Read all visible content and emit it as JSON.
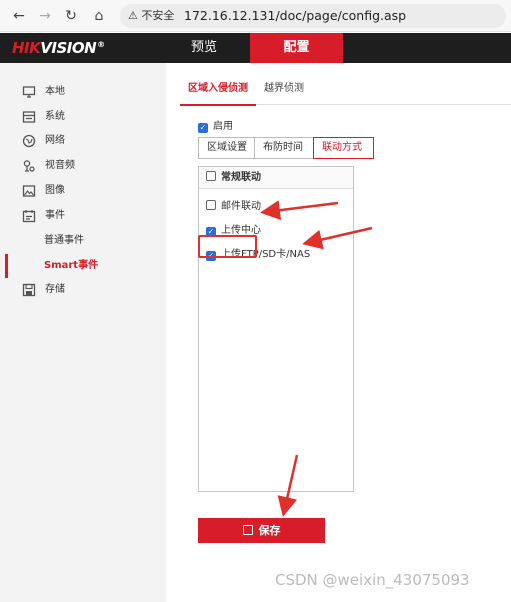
{
  "browser": {
    "security_warning": "不安全",
    "url": "172.16.12.131/doc/page/config.asp"
  },
  "header": {
    "logo": "HIKVISION",
    "menu": {
      "preview": "预览",
      "config": "配置"
    }
  },
  "sidebar": {
    "items": [
      {
        "label": "本地",
        "icon": "monitor-icon"
      },
      {
        "label": "系统",
        "icon": "system-icon"
      },
      {
        "label": "网络",
        "icon": "globe-icon"
      },
      {
        "label": "视音频",
        "icon": "microphone-icon"
      },
      {
        "label": "图像",
        "icon": "image-icon"
      },
      {
        "label": "事件",
        "icon": "calendar-icon"
      },
      {
        "label": "普通事件"
      },
      {
        "label": "Smart事件"
      },
      {
        "label": "存储",
        "icon": "storage-icon"
      }
    ]
  },
  "main": {
    "tabs": [
      "区域入侵侦测",
      "越界侦测"
    ],
    "enable_label": "启用",
    "subtabs": [
      "区域设置",
      "布防时间",
      "联动方式"
    ],
    "linkage": {
      "header": "常规联动",
      "options": [
        {
          "label": "邮件联动",
          "checked": false
        },
        {
          "label": "上传中心",
          "checked": true
        },
        {
          "label": "上传FTP/SD卡/NAS",
          "checked": true
        }
      ]
    },
    "save_label": "保存"
  },
  "watermark": "CSDN @weixin_43075093",
  "colors": {
    "accent": "#d71d2a",
    "annotation": "#e0302a",
    "checkbox": "#2a6fd6"
  }
}
